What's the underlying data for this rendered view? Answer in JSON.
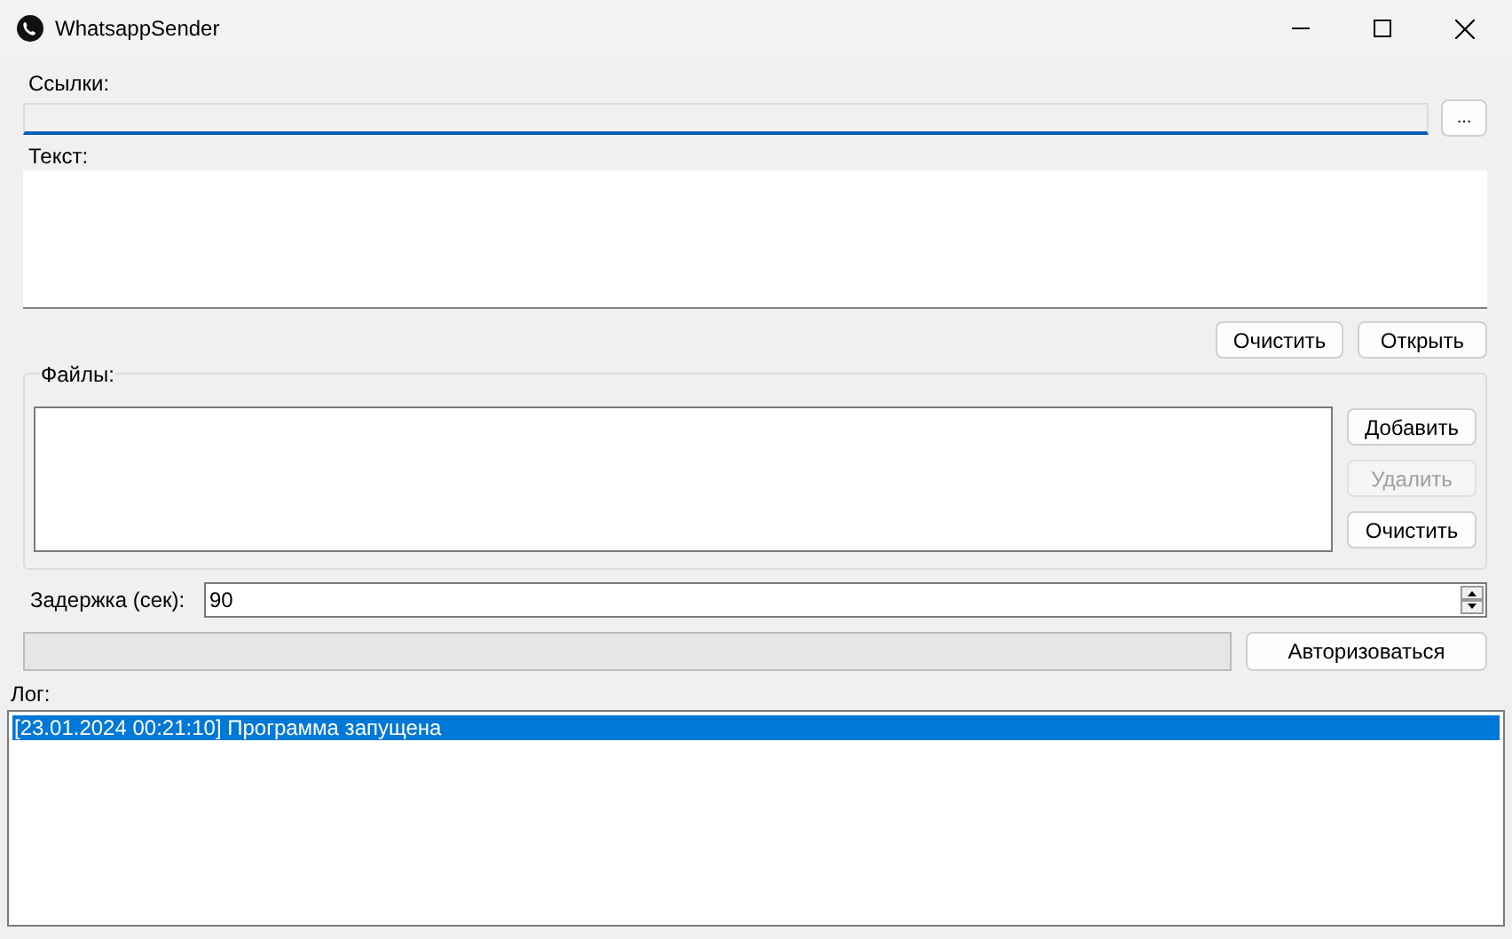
{
  "window": {
    "title": "WhatsappSender"
  },
  "links": {
    "label": "Ссылки:",
    "browse_button": "...",
    "focused": true
  },
  "text": {
    "label": "Текст:"
  },
  "text_buttons": [
    {
      "label": "Очистить",
      "disabled": false
    },
    {
      "label": "Открыть",
      "disabled": false
    }
  ],
  "files": {
    "label": "Файлы:",
    "buttons": [
      {
        "label": "Добавить",
        "disabled": false
      },
      {
        "label": "Удалить",
        "disabled": true
      },
      {
        "label": "Очистить",
        "disabled": false
      }
    ]
  },
  "delay": {
    "label": "Задержка (сек):",
    "value": "90"
  },
  "progress": {
    "level": 0
  },
  "authorize_button": "Авторизоваться",
  "log": {
    "label": "Лог:",
    "items": [
      {
        "text": "[23.01.2024 00:21:10] Программа запущена",
        "selected": true
      }
    ]
  }
}
